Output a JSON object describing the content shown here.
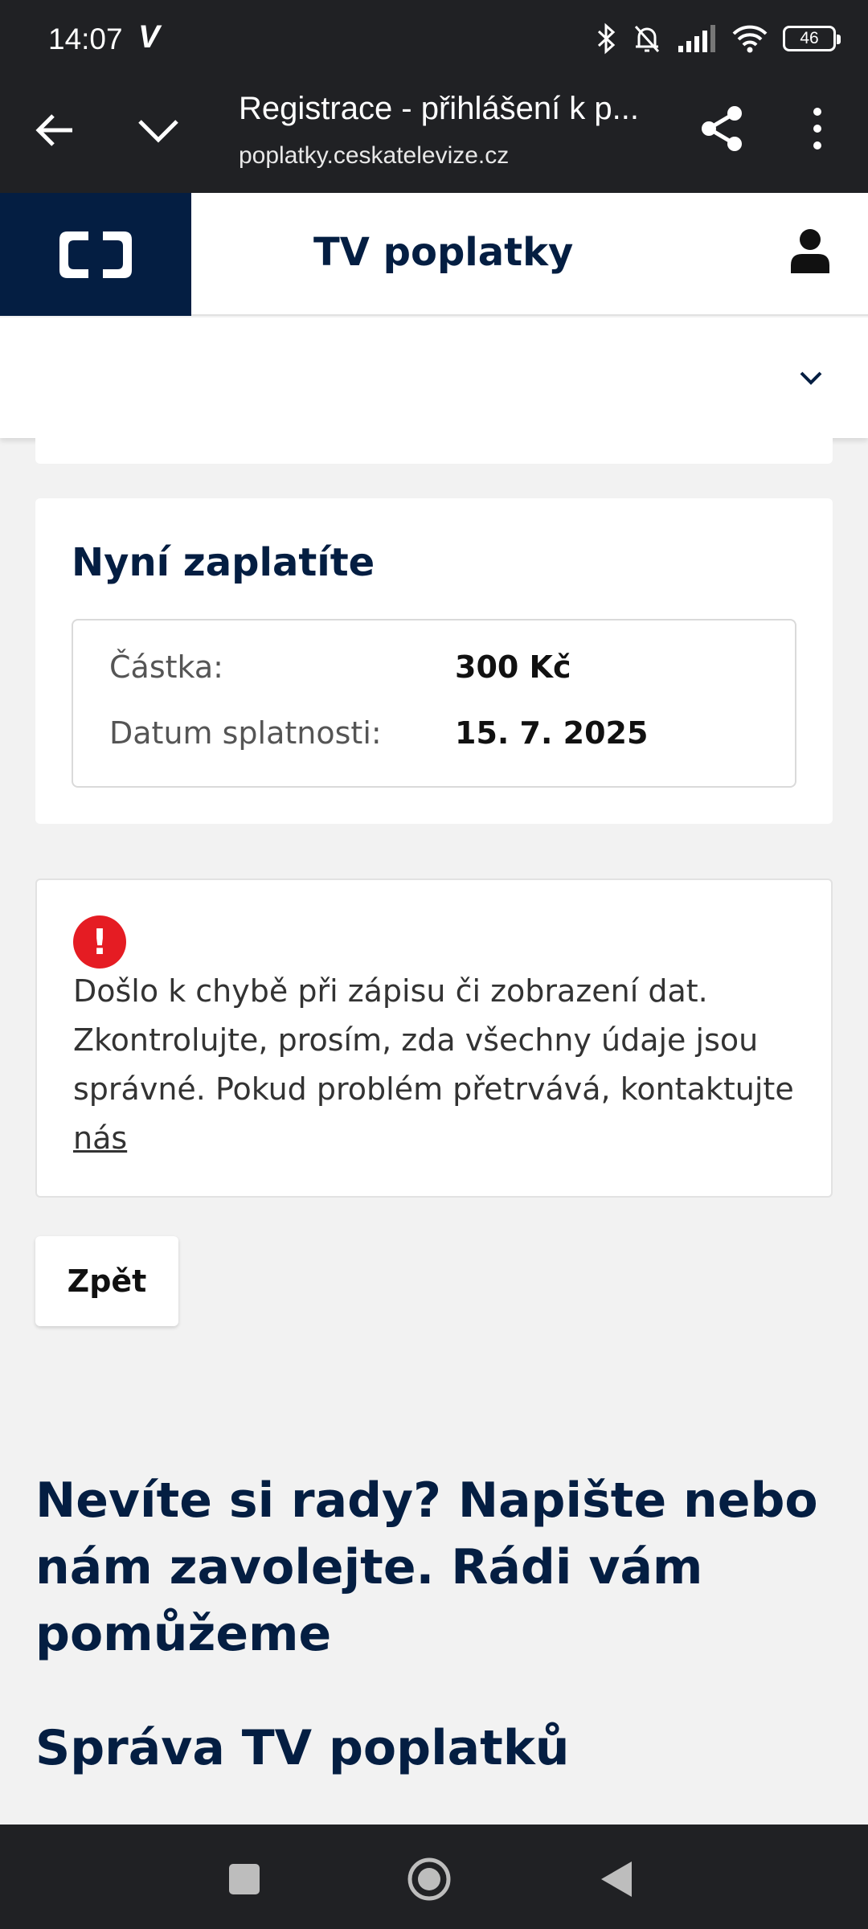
{
  "status_bar": {
    "time": "14:07",
    "carrier_mark": "V",
    "battery": "46",
    "icons": [
      "bluetooth-icon",
      "bell-off-icon",
      "signal-icon",
      "wifi-icon",
      "battery-icon"
    ]
  },
  "browser": {
    "title": "Registrace - přihlášení k p...",
    "url": "poplatky.ceskatelevize.cz"
  },
  "site": {
    "title": "TV poplatky",
    "brand_color": "#041e42"
  },
  "payment": {
    "title": "Nyní zaplatíte",
    "rows": [
      {
        "label": "Částka:",
        "value": "300 Kč"
      },
      {
        "label": "Datum splatnosti:",
        "value": "15. 7. 2025"
      }
    ]
  },
  "error": {
    "icon": "!",
    "message": "Došlo k chybě při zápisu či zobrazení dat. Zkontrolujte, prosím, zda všechny údaje jsou správné. Pokud problém přetrvává, kontaktujte ",
    "link_text": "nás",
    "color": "#e51c23"
  },
  "back_button": "Zpět",
  "help_heading": "Nevíte si rady? Napište nebo nám zavolejte. Rádi vám pomůžeme",
  "section_heading": "Správa TV poplatků"
}
